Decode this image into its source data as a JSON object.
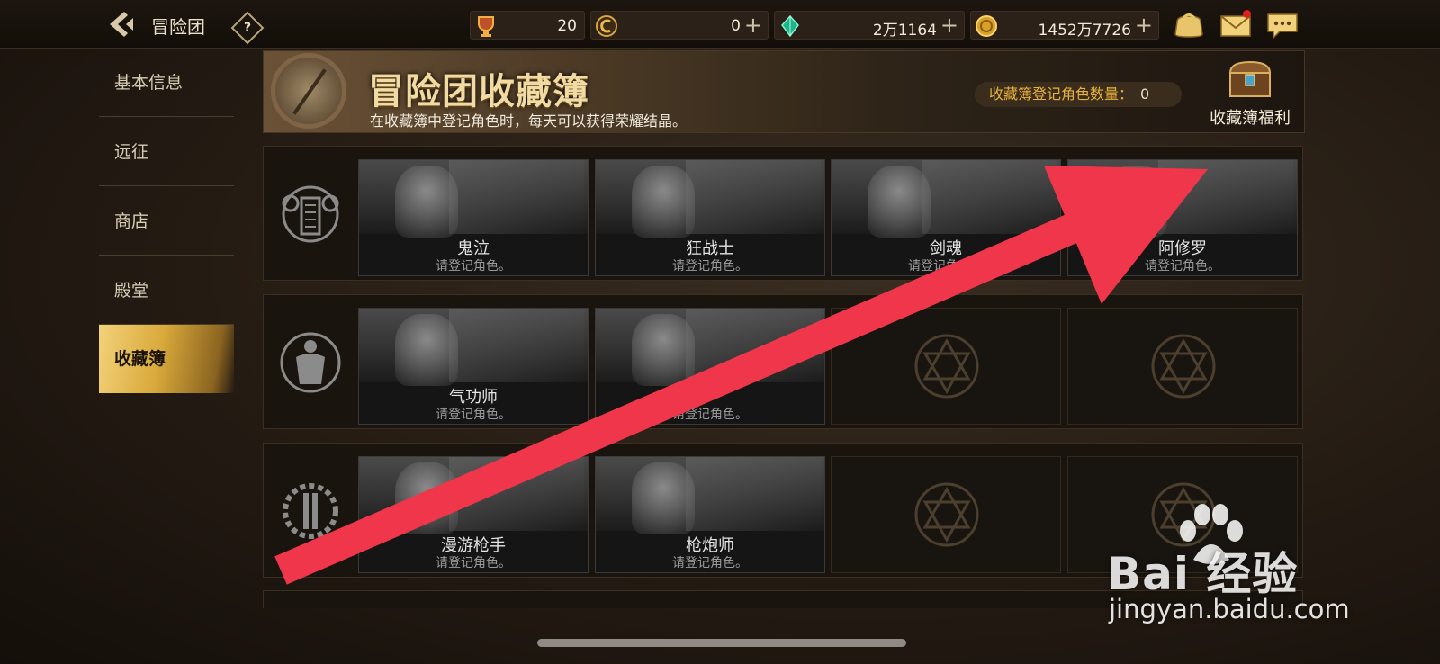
{
  "header": {
    "title": "冒险团",
    "help_label": "?",
    "currencies": [
      {
        "icon": "trophy-icon",
        "value": "20",
        "has_plus": false
      },
      {
        "icon": "c-coin-icon",
        "value": "0",
        "has_plus": true
      },
      {
        "icon": "green-crystal-icon",
        "value": "2万1164",
        "has_plus": true
      },
      {
        "icon": "gold-coin-icon",
        "value": "1452万7726",
        "has_plus": true
      }
    ],
    "plus_label": "+"
  },
  "sidebar": {
    "items": [
      {
        "label": "基本信息",
        "active": false
      },
      {
        "label": "远征",
        "active": false
      },
      {
        "label": "商店",
        "active": false
      },
      {
        "label": "殿堂",
        "active": false
      },
      {
        "label": "收藏簿",
        "active": true
      }
    ]
  },
  "banner": {
    "title": "冒险团收藏簿",
    "subtitle": "在收藏簿中登记角色时，每天可以获得荣耀结晶。",
    "count_label": "收藏簿登记角色数量：",
    "count_value": "0",
    "reward_label": "收藏簿福利"
  },
  "rows": [
    {
      "emblem": "slayer-emblem-icon",
      "cards": [
        {
          "name": "鬼泣",
          "status": "请登记角色。"
        },
        {
          "name": "狂战士",
          "status": "请登记角色。"
        },
        {
          "name": "剑魂",
          "status": "请登记角色。"
        },
        {
          "name": "阿修罗",
          "status": "请登记角色。"
        }
      ]
    },
    {
      "emblem": "fighter-emblem-icon",
      "cards": [
        {
          "name": "气功师",
          "status": "请登记角色。"
        },
        {
          "name": "",
          "status": "请登记角色。"
        },
        {
          "empty": true
        },
        {
          "empty": true
        }
      ]
    },
    {
      "emblem": "gunner-emblem-icon",
      "cards": [
        {
          "name": "漫游枪手",
          "status": "请登记角色。"
        },
        {
          "name": "枪炮师",
          "status": "请登记角色。"
        },
        {
          "empty": true
        },
        {
          "empty": true
        }
      ]
    }
  ],
  "watermark": {
    "brand": "Bai  经验",
    "url": "jingyan.baidu.com"
  },
  "colors": {
    "accent_gold": "#e8b13c",
    "annotation_arrow": "#f0364a",
    "active_tab": "#d9a93b"
  }
}
